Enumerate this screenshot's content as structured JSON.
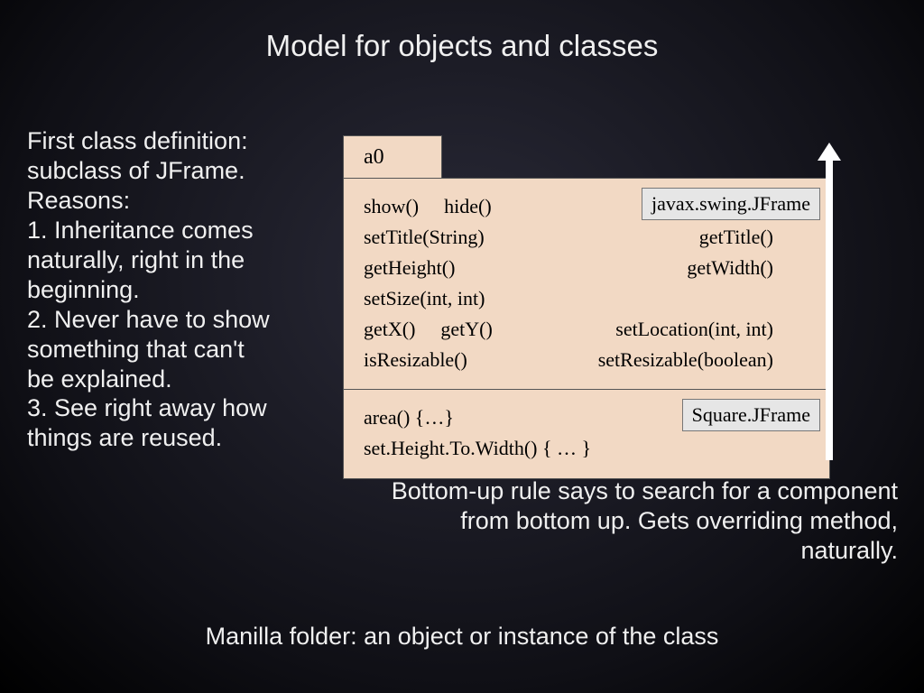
{
  "title": "Model for objects and classes",
  "left": {
    "l1": "First class definition:",
    "l2": "subclass of JFrame.",
    "l3": "Reasons:",
    "l4": "1. Inheritance comes",
    "l5": "naturally, right in the",
    "l6": "beginning.",
    "l7": "2. Never have to show",
    "l8": "something that can't",
    "l9": "be explained.",
    "l10": "3. See right away how",
    "l11": "things are reused."
  },
  "diagram": {
    "instance_id": "a0",
    "superclass": "javax.swing.JFrame",
    "subclass": "Square.JFrame",
    "super_methods": {
      "r1a": "show()",
      "r1b": "hide()",
      "r2a": "setTitle(String)",
      "r2b": "getTitle()",
      "r3a": "getHeight()",
      "r3b": "getWidth()",
      "r4a": "setSize(int, int)",
      "r5a": "getX()",
      "r5b": "getY()",
      "r5c": "setLocation(int, int)",
      "r6a": "isResizable()",
      "r6b": "setResizable(boolean)"
    },
    "sub_methods": {
      "r1": "area() {…}",
      "r2": "set.Height.To.Width() { … }"
    }
  },
  "rule": {
    "l1": "Bottom-up rule says to search for a component",
    "l2": "from bottom up. Gets overriding method,",
    "l3": "naturally."
  },
  "footer": "Manilla folder: an object or instance of the class"
}
